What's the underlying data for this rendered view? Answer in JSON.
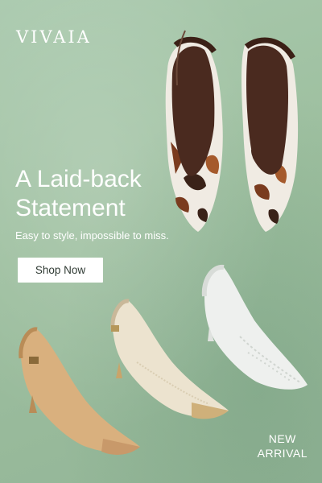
{
  "brand": {
    "name": "VIVAIA"
  },
  "hero": {
    "headline_line1": "A Laid-back",
    "headline_line2": "Statement",
    "subheadline": "Easy to style, impossible to miss."
  },
  "cta": {
    "label": "Shop Now"
  },
  "badge": {
    "line1": "NEW",
    "line2": "ARRIVAL"
  },
  "products": [
    {
      "name": "cow-print-slingback-pair",
      "color": "#f0ebe3"
    },
    {
      "name": "camel-slingback-heel",
      "color": "#d9b07e"
    },
    {
      "name": "cream-woven-slingback-heel",
      "color": "#ece3cf"
    },
    {
      "name": "white-lace-slingback-heel",
      "color": "#eef0ee"
    }
  ],
  "colors": {
    "background": "#a3c5a6",
    "text": "#ffffff",
    "button_bg": "#ffffff"
  }
}
